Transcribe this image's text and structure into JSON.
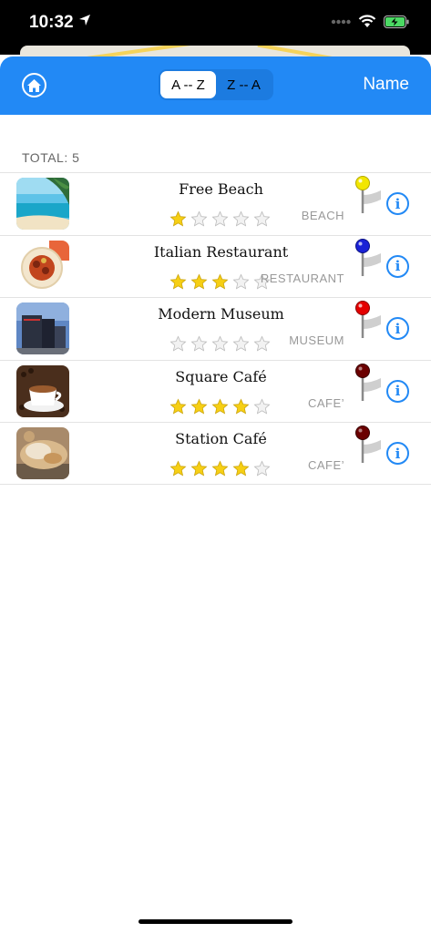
{
  "status_bar": {
    "time": "10:32"
  },
  "nav": {
    "home_icon": "home-icon",
    "sort_options": [
      "A -- Z",
      "Z -- A"
    ],
    "selected_sort": "A -- Z",
    "right_label": "Name",
    "accent_color": "#2289f5"
  },
  "total_label": "TOTAL: 5",
  "places": [
    {
      "name": "Free Beach",
      "rating": 1,
      "category": "BEACH",
      "pin_color": "#f2e600",
      "thumb": "beach"
    },
    {
      "name": "Italian Restaurant",
      "rating": 3,
      "category": "RESTAURANT",
      "pin_color": "#1a22d6",
      "thumb": "pasta"
    },
    {
      "name": "Modern Museum",
      "rating": 0,
      "category": "MUSEUM",
      "pin_color": "#e40000",
      "thumb": "museum"
    },
    {
      "name": "Square Café",
      "rating": 4,
      "category": "CAFE’",
      "pin_color": "#6b0000",
      "thumb": "coffee"
    },
    {
      "name": "Station Café",
      "rating": 4,
      "category": "CAFE’",
      "pin_color": "#6b0000",
      "thumb": "pastry"
    }
  ]
}
